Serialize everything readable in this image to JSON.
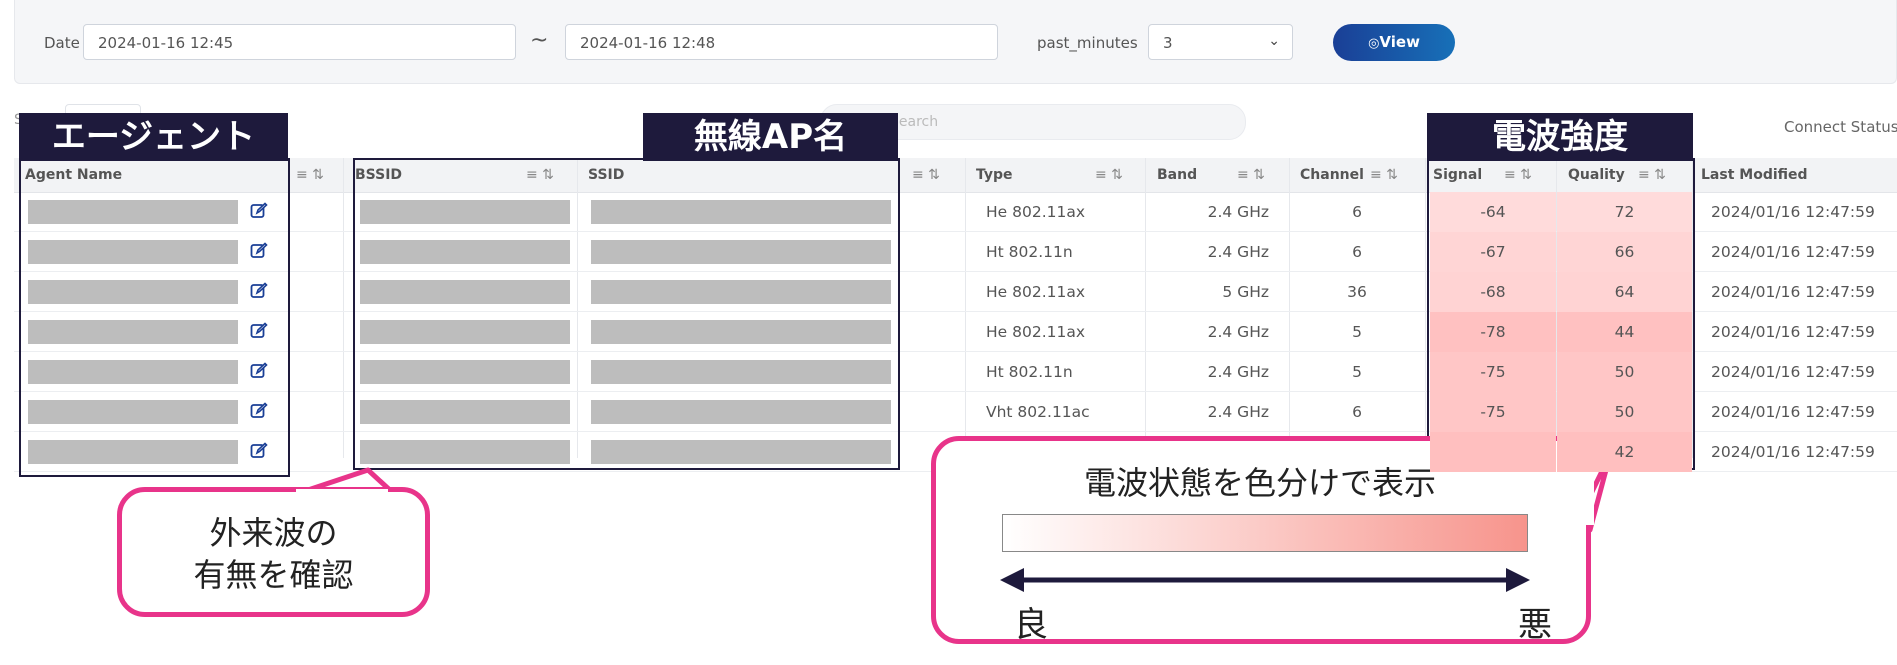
{
  "filters": {
    "date_label": "Date",
    "date_from": "2024-01-16 12:45",
    "date_separator": "~",
    "date_to": "2024-01-16 12:48",
    "past_minutes_label": "past_minutes",
    "past_minutes_value": "3",
    "view_button": "View",
    "view_icon": "eye-icon"
  },
  "toolbar": {
    "search_placeholder": "Search",
    "connect_status_label": "Connect Status"
  },
  "columns": {
    "agent_name": "Agent Name",
    "bssid": "BSSID",
    "ssid": "SSID",
    "type": "Type",
    "band": "Band",
    "channel": "Channel",
    "signal": "Signal",
    "quality": "Quality",
    "last_modified": "Last Modified"
  },
  "rows": [
    {
      "type": "He 802.11ax",
      "band": "2.4 GHz",
      "channel": "6",
      "signal": "-64",
      "quality": "72",
      "last_modified": "2024/01/16 12:47:59"
    },
    {
      "type": "Ht 802.11n",
      "band": "2.4 GHz",
      "channel": "6",
      "signal": "-67",
      "quality": "66",
      "last_modified": "2024/01/16 12:47:59"
    },
    {
      "type": "He 802.11ax",
      "band": "5 GHz",
      "channel": "36",
      "signal": "-68",
      "quality": "64",
      "last_modified": "2024/01/16 12:47:59"
    },
    {
      "type": "He 802.11ax",
      "band": "2.4 GHz",
      "channel": "5",
      "signal": "-78",
      "quality": "44",
      "last_modified": "2024/01/16 12:47:59"
    },
    {
      "type": "Ht 802.11n",
      "band": "2.4 GHz",
      "channel": "5",
      "signal": "-75",
      "quality": "50",
      "last_modified": "2024/01/16 12:47:59"
    },
    {
      "type": "Vht 802.11ac",
      "band": "2.4 GHz",
      "channel": "6",
      "signal": "-75",
      "quality": "50",
      "last_modified": "2024/01/16 12:47:59"
    },
    {
      "type": "",
      "band": "",
      "channel": "",
      "signal": "",
      "quality": "42",
      "last_modified": "2024/01/16 12:47:59"
    }
  ],
  "annotations": {
    "agent_tag": "エージェント",
    "ap_tag": "無線AP名",
    "signal_tag": "電波強度",
    "callout_foreign_line1": "外来波の",
    "callout_foreign_line2": "有無を確認",
    "callout_color_title": "電波状態を色分けで表示",
    "scale_good": "良",
    "scale_bad": "悪"
  },
  "colors": {
    "tag_bg": "#1e1a3c",
    "callout_border": "#e8348a",
    "view_button": "#1a3f96",
    "gradient_end": "#f7948c"
  }
}
